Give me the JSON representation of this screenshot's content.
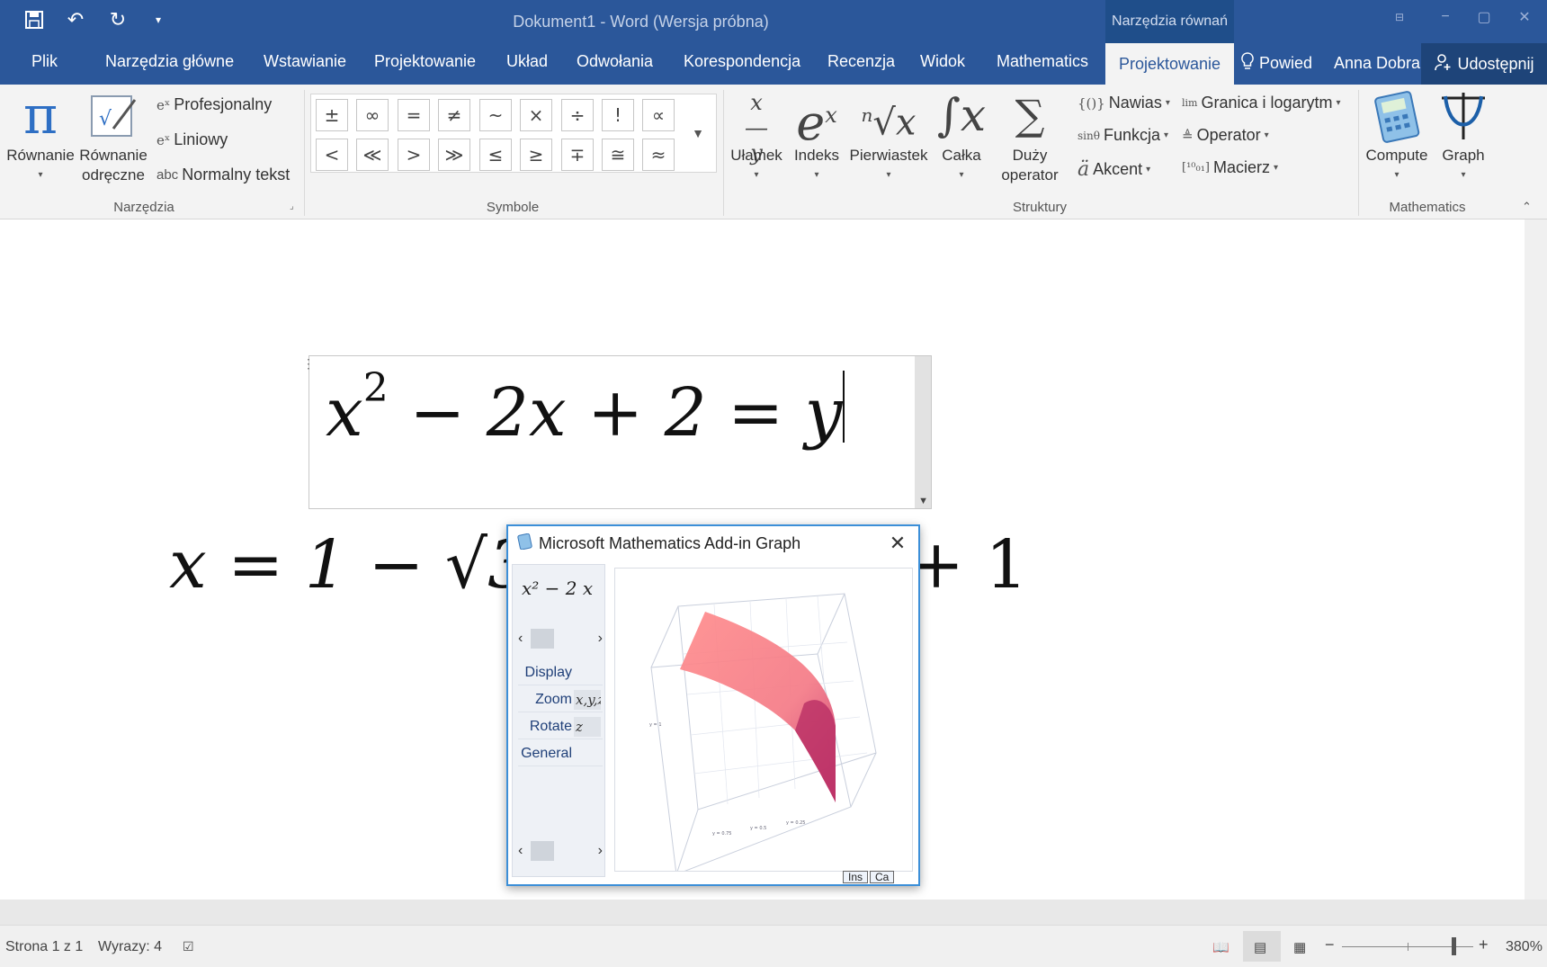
{
  "window": {
    "title": "Dokument1 - Word (Wersja próbna)",
    "context_tab_group": "Narzędzia równań",
    "controls": [
      "−",
      "▢",
      "✕"
    ]
  },
  "quick_access": [
    "save-icon",
    "undo-icon",
    "redo-icon",
    "customize-icon"
  ],
  "tabs": {
    "items": [
      "Plik",
      "Narzędzia główne",
      "Wstawianie",
      "Projektowanie",
      "Układ",
      "Odwołania",
      "Korespondencja",
      "Recenzja",
      "Widok",
      "Mathematics"
    ],
    "active": "Projektowanie",
    "tell_me": "Powiedz mi, co chcesz zrobić",
    "tell_me_visible": "Powied",
    "user": "Anna Dobra",
    "share": "Udostępnij"
  },
  "ribbon": {
    "tools": {
      "label": "Narzędzia",
      "equation": "Równanie",
      "ink_equation_l1": "Równanie",
      "ink_equation_l2": "odręczne",
      "professional": "Profesjonalny",
      "linear": "Liniowy",
      "normal_text": "Normalny tekst"
    },
    "symbols": {
      "label": "Symbole",
      "row1": [
        "±",
        "∞",
        "=",
        "≠",
        "~",
        "×",
        "÷",
        "!",
        "∝"
      ],
      "row2": [
        "<",
        "≪",
        ">",
        "≫",
        "≤",
        "≥",
        "∓",
        "≅",
        "≈"
      ]
    },
    "structures": {
      "label": "Struktury",
      "fraction": "Ułamek",
      "script": "Indeks",
      "radical": "Pierwiastek",
      "integral": "Całka",
      "large_operator_l1": "Duży",
      "large_operator_l2": "operator",
      "bracket": "Nawias",
      "function": "Funkcja",
      "accent": "Akcent",
      "limit_log": "Granica i logarytm",
      "operator": "Operator",
      "matrix": "Macierz"
    },
    "mathematics": {
      "label": "Mathematics",
      "compute": "Compute",
      "graph": "Graph"
    }
  },
  "document": {
    "eq1": {
      "base": "x",
      "exp": "2",
      "rest": " − 2x + 2 = y"
    },
    "eq2_left": "x = 1 − √3",
    "eq2_right": "+ 1"
  },
  "graph_dialog": {
    "title": "Microsoft Mathematics Add-in Graph",
    "equation": "x² − 2 x",
    "menu": [
      "Display",
      "Zoom",
      "Rotate",
      "General"
    ],
    "zoom_mini": "x,y,z",
    "rotate_mini": "z",
    "footer": [
      "Ins",
      "Ca"
    ]
  },
  "statusbar": {
    "page": "Strona 1 z 1",
    "words": "Wyrazy: 4",
    "zoom": "380%"
  }
}
